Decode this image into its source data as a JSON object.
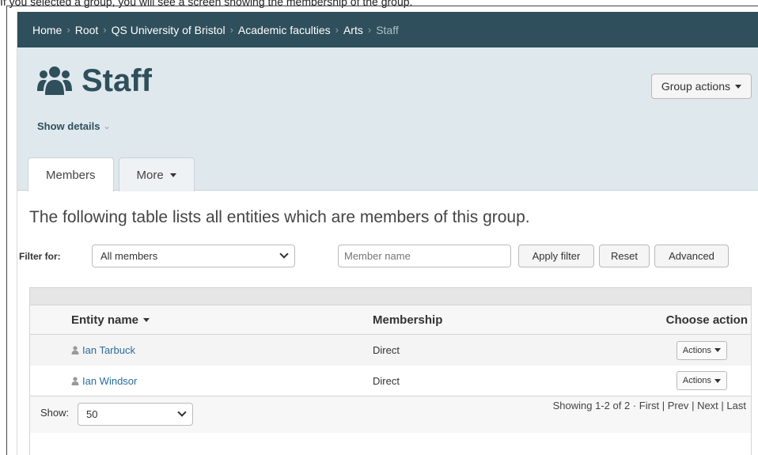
{
  "caption": "If you selected a group, you will see a screen showing the membership of the group.",
  "breadcrumb": {
    "items": [
      "Home",
      "Root",
      "QS University of Bristol",
      "Academic faculties",
      "Arts"
    ],
    "current": "Staff",
    "separator": ">"
  },
  "header": {
    "title": "Staff",
    "icon": "group-icon",
    "group_actions_label": "Group actions",
    "show_details_label": "Show details"
  },
  "tabs": [
    {
      "label": "Members",
      "active": true
    },
    {
      "label": "More",
      "active": false,
      "dropdown": true
    }
  ],
  "intro_text": "The following table lists all entities which are members of this group.",
  "filter": {
    "label": "Filter for:",
    "selected": "All members",
    "placeholder": "Member name",
    "apply_label": "Apply filter",
    "reset_label": "Reset",
    "advanced_label": "Advanced"
  },
  "table": {
    "columns": [
      "Entity name",
      "Membership",
      "Choose action"
    ],
    "rows": [
      {
        "name": "Ian Tarbuck",
        "membership": "Direct",
        "action": "Actions"
      },
      {
        "name": "Ian Windsor",
        "membership": "Direct",
        "action": "Actions"
      }
    ]
  },
  "footer": {
    "show_label": "Show:",
    "page_size": "50",
    "showing": "Showing 1-2 of 2",
    "first": "First",
    "prev": "Prev",
    "next": "Next",
    "last": "Last"
  },
  "colors": {
    "breadcrumb_bg": "#2e4f5b",
    "header_bg": "#dfe8ec",
    "title": "#2e4f5b",
    "link": "#2a6d9e"
  }
}
